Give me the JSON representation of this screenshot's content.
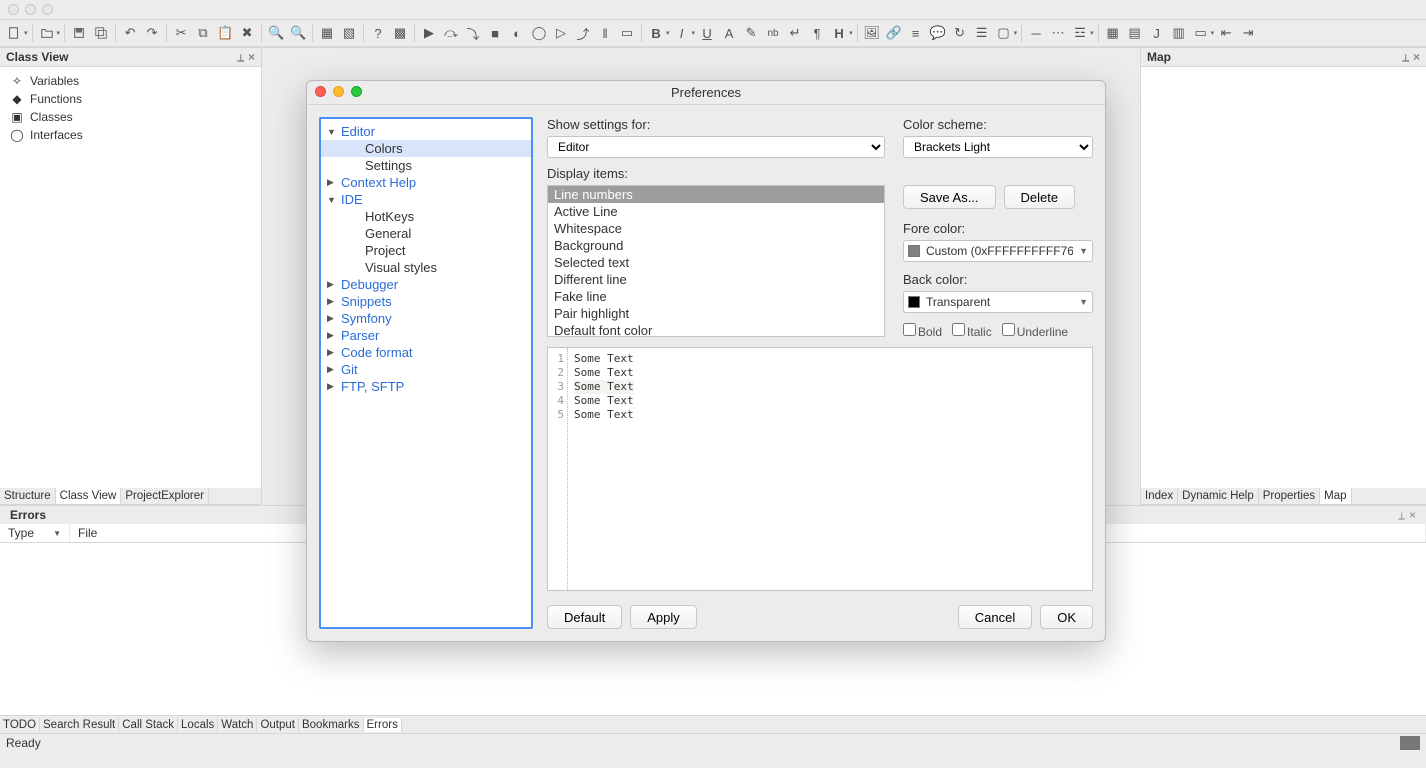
{
  "window": {
    "title": ""
  },
  "classview": {
    "title": "Class View",
    "items": [
      "Variables",
      "Functions",
      "Classes",
      "Interfaces"
    ]
  },
  "classview_tabs": [
    "Structure",
    "Class View",
    "ProjectExplorer"
  ],
  "classview_tabs_active": 1,
  "map": {
    "title": "Map"
  },
  "map_tabs": [
    "Index",
    "Dynamic Help",
    "Properties",
    "Map"
  ],
  "map_tabs_active": 3,
  "errors": {
    "title": "Errors",
    "col_type": "Type",
    "col_file": "File"
  },
  "bottom_tabs": [
    "TODO",
    "Search Result",
    "Call Stack",
    "Locals",
    "Watch",
    "Output",
    "Bookmarks",
    "Errors"
  ],
  "bottom_tabs_active": 7,
  "status": {
    "text": "Ready"
  },
  "dialog": {
    "title": "Preferences",
    "tree": [
      {
        "label": "Editor",
        "kind": "parent",
        "open": true
      },
      {
        "label": "Colors",
        "kind": "child",
        "selected": true
      },
      {
        "label": "Settings",
        "kind": "child"
      },
      {
        "label": "Context Help",
        "kind": "parent",
        "open": false
      },
      {
        "label": "IDE",
        "kind": "parent",
        "open": true
      },
      {
        "label": "HotKeys",
        "kind": "child"
      },
      {
        "label": "General",
        "kind": "child"
      },
      {
        "label": "Project",
        "kind": "child"
      },
      {
        "label": "Visual styles",
        "kind": "child"
      },
      {
        "label": "Debugger",
        "kind": "parent",
        "open": false
      },
      {
        "label": "Snippets",
        "kind": "parent",
        "open": false
      },
      {
        "label": "Symfony",
        "kind": "parent",
        "open": false
      },
      {
        "label": "Parser",
        "kind": "parent",
        "open": false
      },
      {
        "label": "Code format",
        "kind": "parent",
        "open": false
      },
      {
        "label": "Git",
        "kind": "parent",
        "open": false
      },
      {
        "label": "FTP, SFTP",
        "kind": "parent",
        "open": false
      }
    ],
    "show_settings_label": "Show settings for:",
    "show_settings_value": "Editor",
    "color_scheme_label": "Color scheme:",
    "color_scheme_value": "Brackets Light",
    "display_items_label": "Display items:",
    "display_items": [
      "Line numbers",
      "Active Line",
      "Whitespace",
      "Background",
      "Selected text",
      "Different line",
      "Fake line",
      "Pair highlight",
      "Default font color"
    ],
    "display_items_selected": 0,
    "save_as_label": "Save As...",
    "delete_label": "Delete",
    "fore_label": "Fore color:",
    "fore_value": "Custom (0xFFFFFFFFFF76",
    "fore_swatch": "#808080",
    "back_label": "Back color:",
    "back_value": "Transparent",
    "back_swatch": "#000000",
    "chk_bold": "Bold",
    "chk_italic": "Italic",
    "chk_underline": "Underline",
    "preview_lines": [
      "Some Text",
      "Some Text",
      "Some Text",
      "Some Text",
      "Some Text"
    ],
    "btn_default": "Default",
    "btn_apply": "Apply",
    "btn_cancel": "Cancel",
    "btn_ok": "OK"
  },
  "toolbar_icons": [
    "file-new",
    "file-new-caret",
    "sep",
    "folder-open",
    "folder-open-caret",
    "sep",
    "save",
    "save-all",
    "sep",
    "undo",
    "redo",
    "sep",
    "cut",
    "copy",
    "paste",
    "delete",
    "sep",
    "find",
    "find-caret",
    "sep",
    "build",
    "build2",
    "sep",
    "doc1",
    "doc2",
    "sep",
    "help",
    "settings-icon"
  ]
}
